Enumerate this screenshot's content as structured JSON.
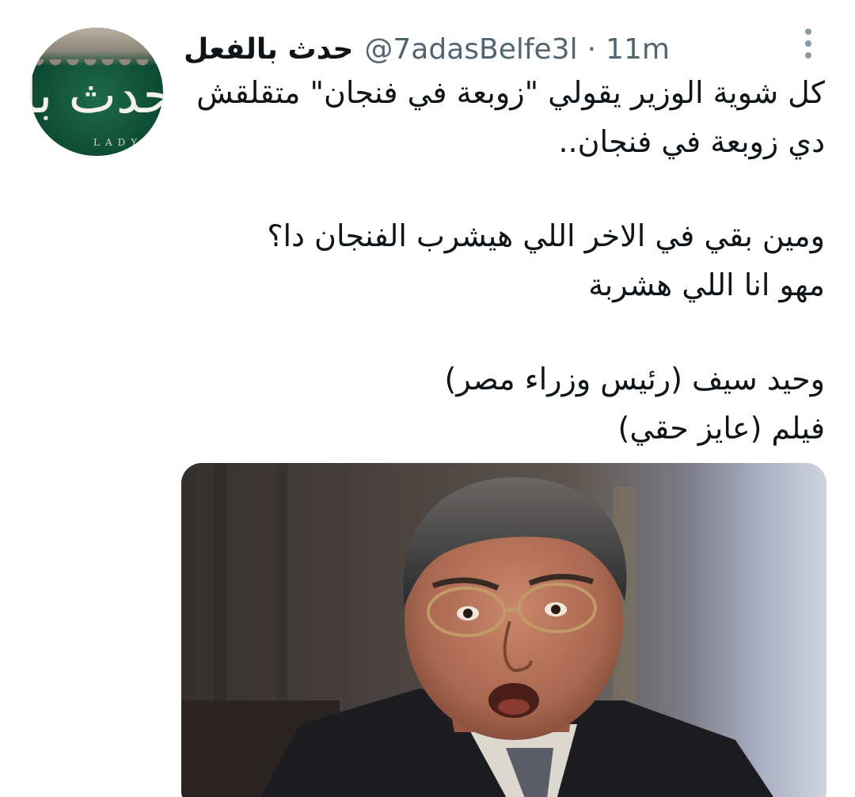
{
  "author": {
    "display_name": "حدث بالفعل",
    "handle": "@7adasBelfe3l",
    "separator": "·",
    "timestamp": "11m",
    "avatar_logo_text": "حدث بالفعل",
    "avatar_sub_text": "LADY HA"
  },
  "tweet": {
    "lines": [
      "كل شوية الوزير يقولي \"زوبعة في فنجان\" متقلقش",
      "دي زوبعة في فنجان..",
      "ومين بقي في الاخر اللي هيشرب الفنجان دا؟",
      "مهو انا اللي هشربة",
      "وحيد سيف (رئيس وزراء مصر)",
      "فيلم (عايز حقي)"
    ]
  },
  "icons": {
    "more": "more-vertical-icon"
  },
  "colors": {
    "text": "#0f1419",
    "secondary": "#536471",
    "avatar_bg": "#0f4d35"
  }
}
